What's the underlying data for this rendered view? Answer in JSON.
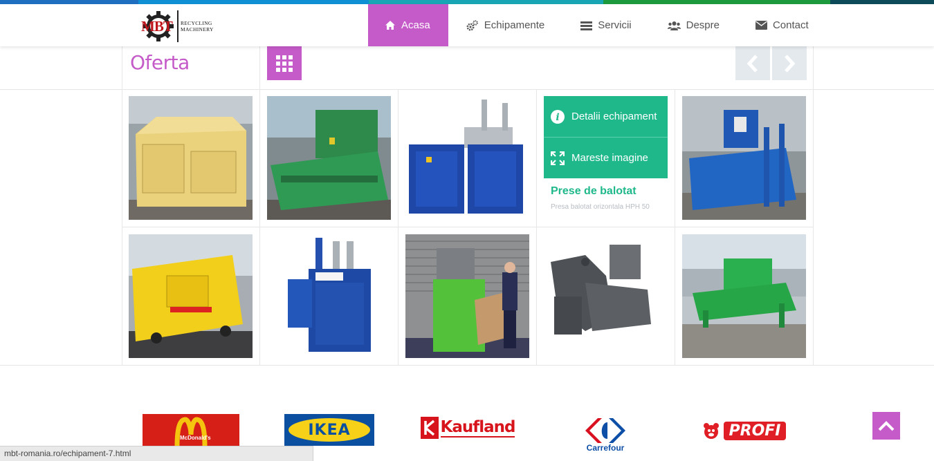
{
  "logo": {
    "word": "MBT",
    "sub_line1": "RECYCLING",
    "sub_line2": "MACHINERY"
  },
  "stripe_colors": [
    "#1f6fc1",
    "#0f8fd4",
    "#18a6b5",
    "#1e9a3e",
    "#0d4a5a"
  ],
  "nav": {
    "items": [
      {
        "label": "Acasa",
        "icon": "home-icon",
        "active": true
      },
      {
        "label": "Echipamente",
        "icon": "gears-icon"
      },
      {
        "label": "Servicii",
        "icon": "list-icon"
      },
      {
        "label": "Despre",
        "icon": "users-icon"
      },
      {
        "label": "Contact",
        "icon": "envelope-icon"
      }
    ]
  },
  "section": {
    "title": "Oferta"
  },
  "colors": {
    "accent": "#c55ac9",
    "green": "#1fb88b",
    "arrow_bg": "#e4e9ee"
  },
  "overlay": {
    "details_label": "Detalii echipament",
    "zoom_label": "Mareste imagine",
    "product_title": "Prese de balotat",
    "product_subtitle": "Presa balotat orizontala HPH 50"
  },
  "products": [
    {
      "name": "yellow-compactor"
    },
    {
      "name": "green-compactor"
    },
    {
      "name": "blue-twin-baler"
    },
    {
      "name": "blue-horizontal-compactor"
    },
    {
      "name": "yellow-container-compactor"
    },
    {
      "name": "blue-vertical-baler"
    },
    {
      "name": "green-baler-operator"
    },
    {
      "name": "grey-baler"
    },
    {
      "name": "green-station-compactor"
    }
  ],
  "brands": [
    {
      "name": "McDonald's"
    },
    {
      "name": "IKEA"
    },
    {
      "name": "Kaufland"
    },
    {
      "name": "Carrefour"
    },
    {
      "name": "PROFI"
    }
  ],
  "status_url": "mbt-romania.ro/echipament-7.html"
}
